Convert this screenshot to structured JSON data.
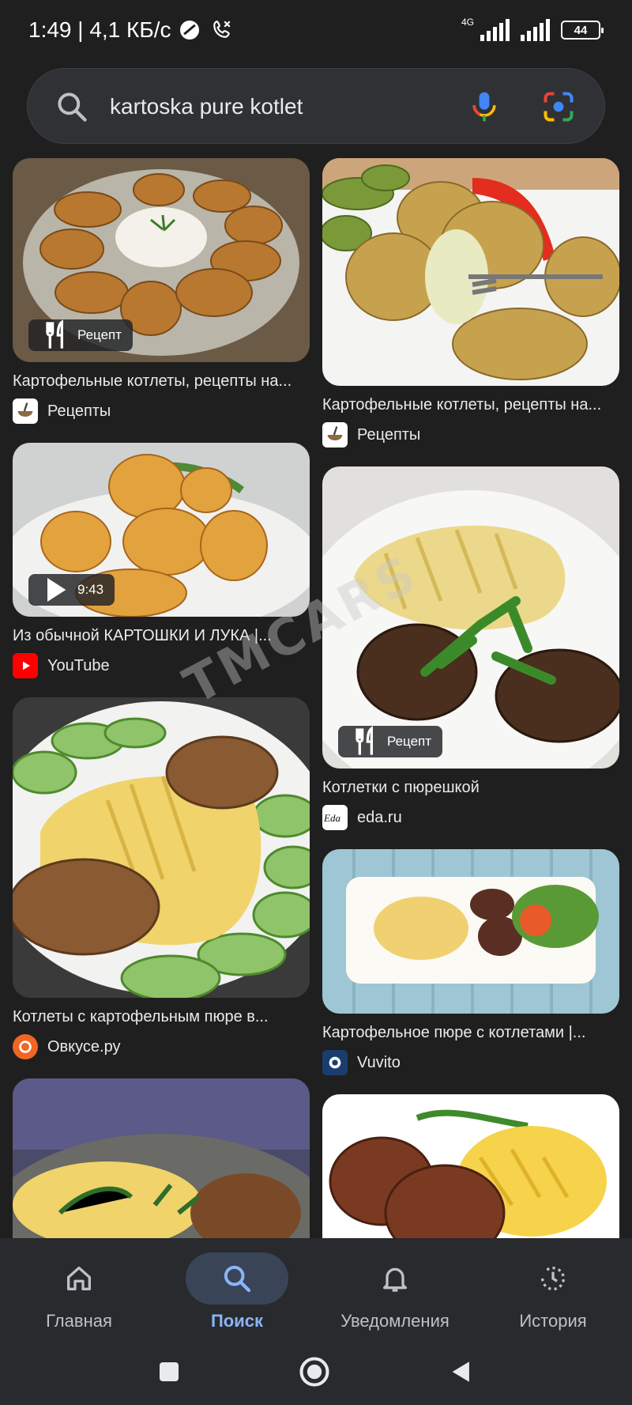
{
  "status_bar": {
    "time_speed": "1:49 | 4,1 КБ/с",
    "network": "4G",
    "battery": "44"
  },
  "search": {
    "query": "kartoska pure kotlet"
  },
  "results": {
    "left": [
      {
        "title": "Картофельные котлеты, рецепты на...",
        "source": "Рецепты",
        "badge": "Рецепт",
        "badge_icon": "cutlery-icon",
        "favicon": "recipe-bowl"
      },
      {
        "title": "Из обычной КАРТОШКИ И ЛУКА |...",
        "source": "YouTube",
        "badge": "9:43",
        "badge_icon": "play-icon",
        "favicon": "youtube"
      },
      {
        "title": "Котлеты с картофельным пюре в...",
        "source": "Овкусе.ру",
        "favicon": "ovkuse"
      },
      {
        "title": "",
        "source": ""
      }
    ],
    "right": [
      {
        "title": "Картофельные котлеты, рецепты на...",
        "source": "Рецепты",
        "favicon": "recipe-bowl"
      },
      {
        "title": "Котлетки с пюрешкой",
        "source": "eda.ru",
        "badge": "Рецепт",
        "badge_icon": "cutlery-icon",
        "favicon": "eda"
      },
      {
        "title": "Картофельное пюре с котлетами |...",
        "source": "Vuvito",
        "favicon": "vuvito"
      },
      {
        "title": "",
        "source": ""
      }
    ]
  },
  "bottom_nav": [
    {
      "label": "Главная",
      "icon": "home-icon"
    },
    {
      "label": "Поиск",
      "icon": "search-icon",
      "active": true
    },
    {
      "label": "Уведомления",
      "icon": "bell-icon"
    },
    {
      "label": "История",
      "icon": "history-icon"
    }
  ],
  "watermark": "TMCARS",
  "colors": {
    "background": "#1f1f1f",
    "search_bg": "#303134",
    "nav_active_bg": "#394457",
    "nav_active_text": "#8ab4f8",
    "youtube_red": "#ff0000"
  }
}
